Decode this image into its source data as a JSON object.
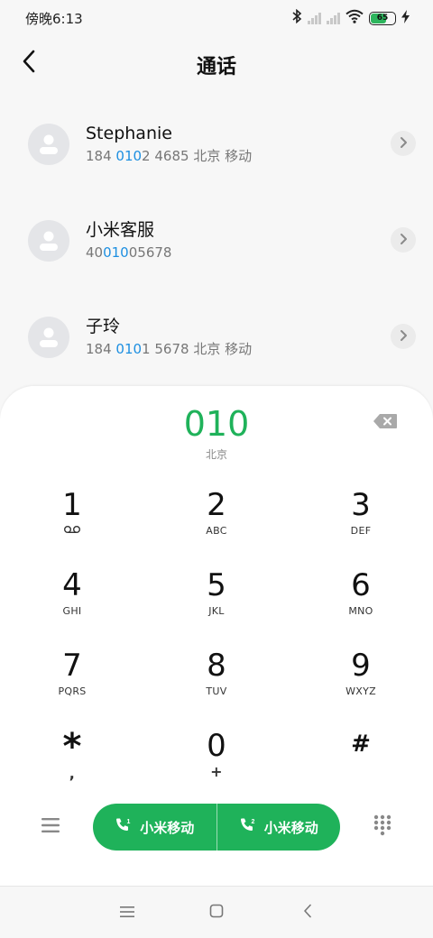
{
  "status_bar": {
    "time": "傍晚6:13",
    "battery_level": "65",
    "icons": [
      "bluetooth-icon",
      "signal-icon",
      "signal-icon",
      "wifi-icon",
      "battery-icon",
      "charging-icon"
    ]
  },
  "header": {
    "title": "通话",
    "back_icon": "chevron-left-icon"
  },
  "contacts": [
    {
      "name": "Stephanie",
      "number_pre": "184 ",
      "number_hl": "010",
      "number_post": "2 4685",
      "location": "北京 移动"
    },
    {
      "name": "小米客服",
      "number_pre": "40",
      "number_hl": "010",
      "number_post": "05678",
      "location": ""
    },
    {
      "name": "子玲",
      "number_pre": "184 ",
      "number_hl": "010",
      "number_post": "1 5678",
      "location": "北京 移动"
    }
  ],
  "dialer": {
    "number": "010",
    "location": "北京",
    "keys": [
      {
        "digit": "1",
        "letters": "voicemail-icon"
      },
      {
        "digit": "2",
        "letters": "ABC"
      },
      {
        "digit": "3",
        "letters": "DEF"
      },
      {
        "digit": "4",
        "letters": "GHI"
      },
      {
        "digit": "5",
        "letters": "JKL"
      },
      {
        "digit": "6",
        "letters": "MNO"
      },
      {
        "digit": "7",
        "letters": "PQRS"
      },
      {
        "digit": "8",
        "letters": "TUV"
      },
      {
        "digit": "9",
        "letters": "WXYZ"
      },
      {
        "digit": "*",
        "letters": ","
      },
      {
        "digit": "0",
        "letters": "+"
      },
      {
        "digit": "#",
        "letters": ""
      }
    ],
    "call_sim1_label": "小米移动",
    "call_sim2_label": "小米移动",
    "sim1_badge": "1",
    "sim2_badge": "2"
  },
  "colors": {
    "accent_green": "#1fb25a",
    "highlight_blue": "#1d8fe1"
  }
}
